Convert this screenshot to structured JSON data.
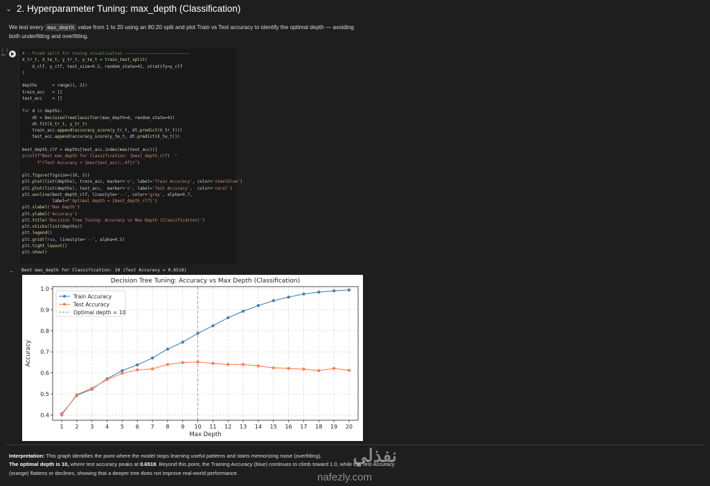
{
  "section": {
    "title": "2. Hyperparameter Tuning: max_depth (Classification)",
    "desc_pre": "We test every",
    "desc_code": "max_depth",
    "desc_post": "value from 1 to 20 using an 80:20 split and plot Train vs Test accuracy to identify the optimal depth — avoiding both underfitting and overfitting."
  },
  "cell": {
    "gutter_top": "[ ]",
    "gutter_bottom": "0s",
    "code_lines": [
      "# — Fixed split for tuning visualisation ——————————————————————————",
      "X_tr_t, X_te_t, y_tr_t, y_te_t = train_test_split(",
      "    X_clf, y_clf, test_size=0.2, random_state=42, stratify=y_clf",
      ")",
      "",
      "depths      = range(1, 21)",
      "train_acc   = []",
      "test_acc    = []",
      "",
      "for d in depths:",
      "    dt = DecisionTreeClassifier(max_depth=d, random_state=42)",
      "    dt.fit(X_tr_t, y_tr_t)",
      "    train_acc.append(accuracy_score(y_tr_t, dt.predict(X_tr_t)))",
      "    test_acc.append(accuracy_score(y_te_t, dt.predict(X_te_t)))",
      "",
      "best_depth_clf = depths[test_acc.index(max(test_acc))]",
      "print(f\"Best max_depth for Classification: {best_depth_clf}  \"",
      "      f\"(Test Accuracy = {max(test_acc):.4f})\")",
      "",
      "plt.figure(figsize=(10, 5))",
      "plt.plot(list(depths), train_acc, marker='o', label='Train Accuracy', color='steelblue')",
      "plt.plot(list(depths), test_acc,  marker='o', label='Test Accuracy',  color='coral')",
      "plt.axvline(best_depth_clf, linestyle='--', color='gray', alpha=0.7,",
      "            label=f'Optimal depth = {best_depth_clf}')",
      "plt.xlabel('Max Depth')",
      "plt.ylabel('Accuracy')",
      "plt.title('Decision Tree Tuning: Accuracy vs Max Depth (Classification)')",
      "plt.xticks(list(depths))",
      "plt.legend()",
      "plt.grid(True, linestyle='--', alpha=0.5)",
      "plt.tight_layout()",
      "plt.show()"
    ]
  },
  "output": {
    "gutter": "...",
    "text": "Best max_depth for Classification: 10  (Test Accuracy = 0.6518)"
  },
  "chart_data": {
    "type": "line",
    "title": "Decision Tree Tuning: Accuracy vs Max Depth (Classification)",
    "xlabel": "Max Depth",
    "ylabel": "Accuracy",
    "x": [
      1,
      2,
      3,
      4,
      5,
      6,
      7,
      8,
      9,
      10,
      11,
      12,
      13,
      14,
      15,
      16,
      17,
      18,
      19,
      20
    ],
    "xlim": [
      0.4,
      20.6
    ],
    "ylim": [
      0.375,
      1.01
    ],
    "yticks": [
      0.4,
      0.5,
      0.6,
      0.7,
      0.8,
      0.9,
      1.0
    ],
    "series": [
      {
        "name": "Train Accuracy",
        "color": "#4682b4",
        "values": [
          0.405,
          0.493,
          0.523,
          0.572,
          0.611,
          0.638,
          0.671,
          0.713,
          0.746,
          0.788,
          0.824,
          0.862,
          0.893,
          0.92,
          0.943,
          0.96,
          0.975,
          0.984,
          0.99,
          0.994
        ]
      },
      {
        "name": "Test Accuracy",
        "color": "#ff7f50",
        "values": [
          0.4,
          0.497,
          0.527,
          0.568,
          0.598,
          0.614,
          0.619,
          0.64,
          0.649,
          0.6518,
          0.645,
          0.64,
          0.64,
          0.633,
          0.624,
          0.621,
          0.618,
          0.611,
          0.621,
          0.612
        ]
      }
    ],
    "vline": {
      "x": 10,
      "label": "Optimal depth = 10",
      "color": "#808080"
    },
    "legend_position": "upper-left",
    "grid": true
  },
  "interpretation": {
    "label": "Interpretation:",
    "text1": " This graph identifies the point where the model stops learning useful patterns and starts memorizing noise (overfitting).",
    "bold2": "The optimal depth is 10,",
    "text2": " where test accuracy peaks at ",
    "bold3": "0.6518",
    "text3": ". Beyond this point, the Training Accuracy (blue) continues to climb toward 1.0, while the Test Accuracy (orange) flattens or declines, showing that a deeper tree does not improve real-world performance."
  },
  "watermark": {
    "arabic": "نفذلي",
    "latin": "nafezly.com"
  }
}
